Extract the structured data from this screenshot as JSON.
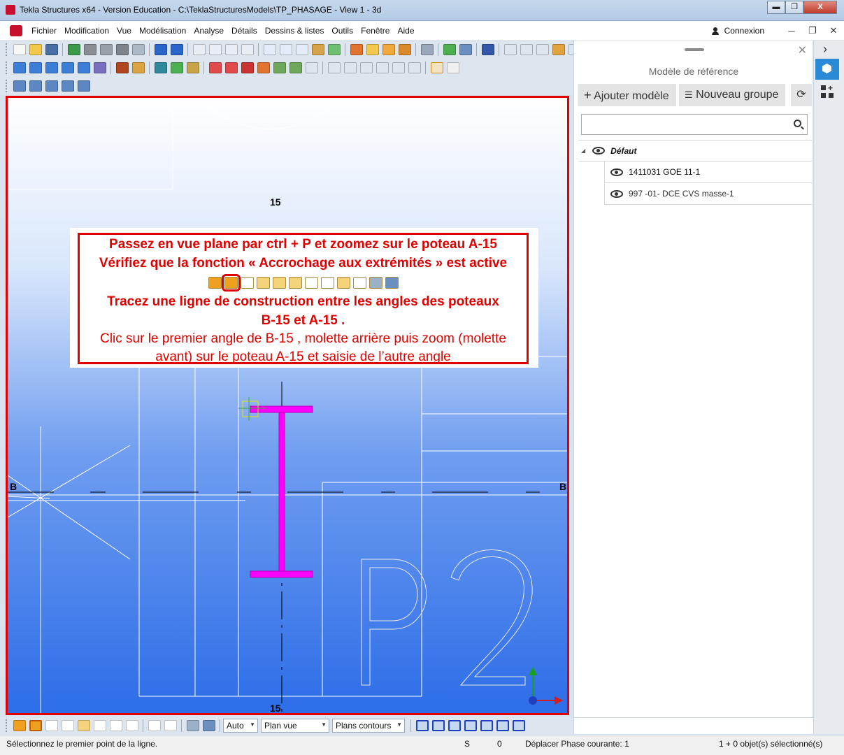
{
  "window": {
    "title": "Tekla Structures x64 - Version Education - C:\\TeklaStructuresModels\\TP_PHASAGE - View 1 - 3d",
    "minimize": "▬",
    "restore": "❐",
    "close": "X"
  },
  "menu": {
    "items": [
      "Fichier",
      "Modification",
      "Vue",
      "Modélisation",
      "Analyse",
      "Détails",
      "Dessins & listes",
      "Outils",
      "Fenêtre",
      "Aide"
    ],
    "connexion": "Connexion",
    "mdi_minimize": "─",
    "mdi_restore": "❐",
    "mdi_close": "✕"
  },
  "viewport": {
    "grid_label_top": "15",
    "grid_label_bottom": "15",
    "grid_label_left": "B",
    "grid_label_right": "B",
    "text_p2": "P2"
  },
  "callout": {
    "line1": "Passez en vue plane par ctrl + P et zoomez sur le poteau A-15",
    "line2": "Vérifiez que la fonction « Accrochage aux extrémités » est active",
    "line3": "Tracez une ligne de construction entre les angles des poteaux",
    "line4": "B-15 et A-15 .",
    "line5": "Clic sur le premier angle de B-15 , molette arrière puis zoom (molette",
    "line6": "avant) sur le poteau A-15 et saisie de l’autre angle"
  },
  "bottom_toolbar": {
    "snap_mode": "Auto",
    "view_plane": "Plan vue",
    "contour_planes": "Plans contours"
  },
  "status": {
    "prompt": "Sélectionnez le premier point de la ligne.",
    "s_label": "S",
    "s_value": "0",
    "phase": "Déplacer Phase courante: 1",
    "selection": "1 + 0 objet(s) sélectionné(s)"
  },
  "panel": {
    "title": "Modèle de référence",
    "add_model": "Ajouter modèle",
    "new_group": "Nouveau groupe",
    "refresh_icon": "⟳",
    "search_placeholder": "",
    "group_name": "Défaut",
    "models": [
      "1411031 GOE 11-1",
      "997 -01- DCE CVS masse-1"
    ],
    "close_icon": "✕",
    "collapse_arrow": "◢"
  },
  "rail": {
    "chevron": "›"
  },
  "colors": {
    "accent_red": "#e00000",
    "beam_magenta": "#ff00ff",
    "panel_blue": "#2a8ad8"
  }
}
